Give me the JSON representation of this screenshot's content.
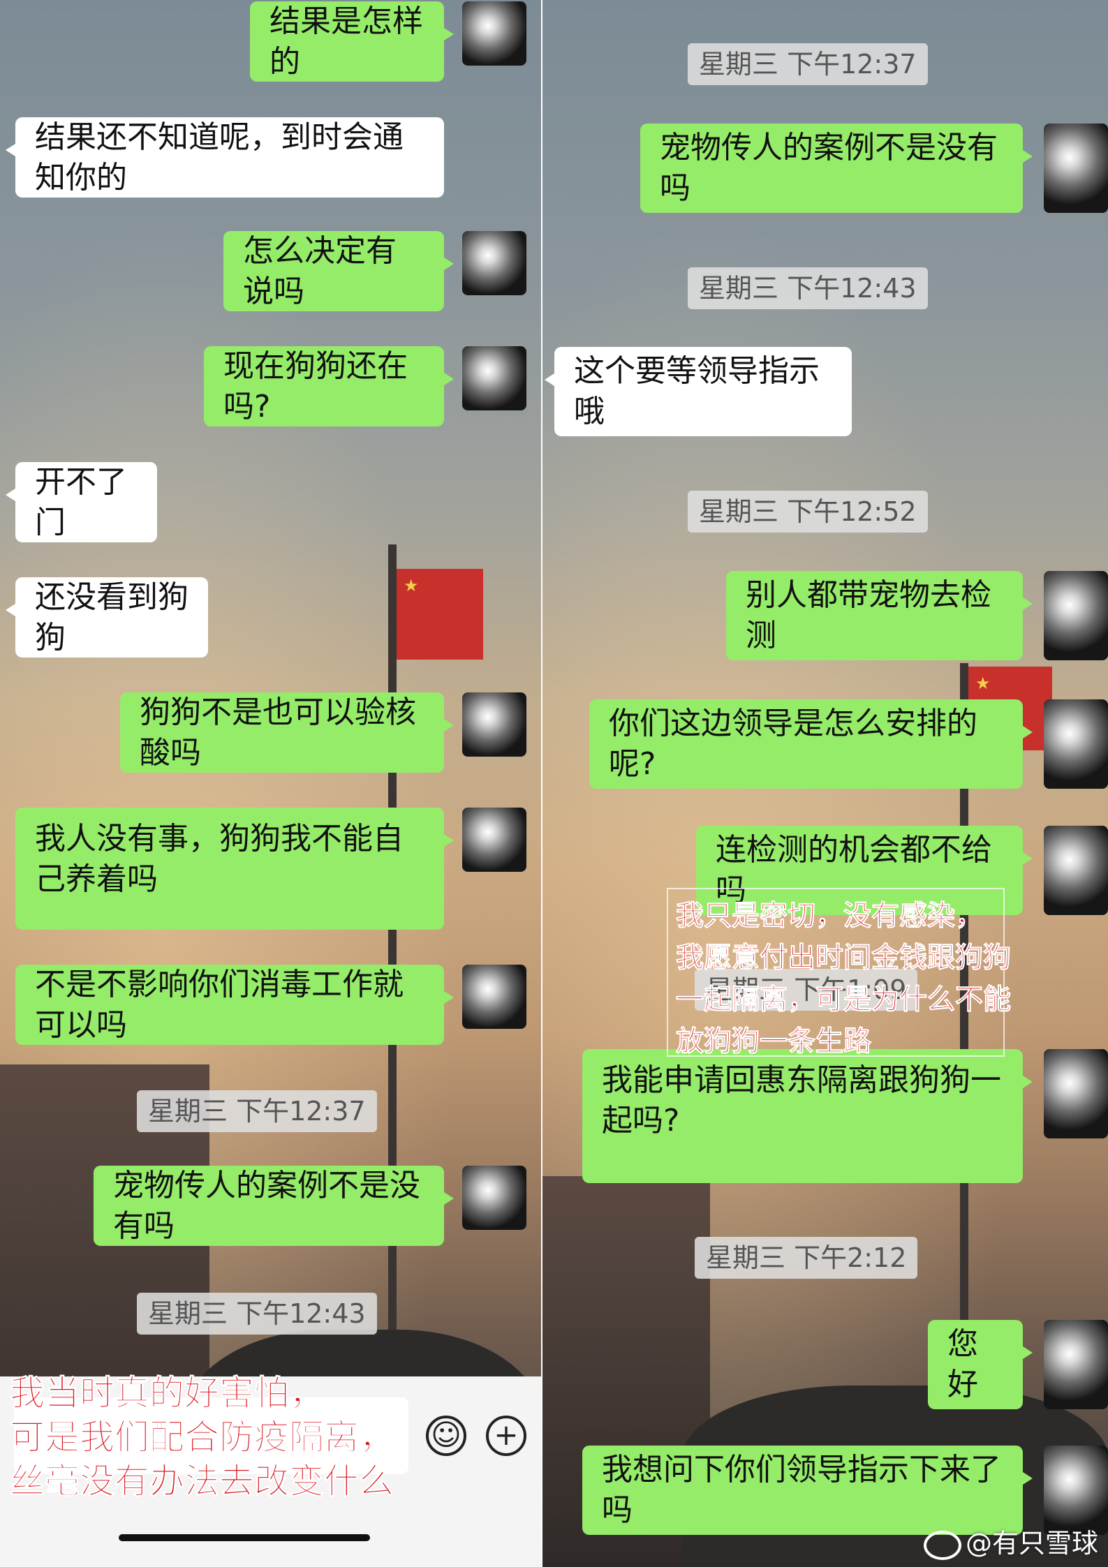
{
  "left_panel": {
    "messages": [
      {
        "side": "me",
        "text": "结果是怎样的"
      },
      {
        "side": "other",
        "text": "结果还不知道呢，到时会通知你的"
      },
      {
        "side": "me",
        "text": "怎么决定有说吗"
      },
      {
        "side": "me",
        "text": "现在狗狗还在吗?"
      },
      {
        "side": "other",
        "text": "开不了门"
      },
      {
        "side": "other",
        "text": "还没看到狗狗"
      },
      {
        "side": "me",
        "text": "狗狗不是也可以验核酸吗"
      },
      {
        "side": "me",
        "text": "我人没有事，狗狗我不能自己养着吗"
      },
      {
        "side": "me",
        "text": "不是不影响你们消毒工作就可以吗"
      },
      {
        "side": "time",
        "text": "星期三 下午12:37"
      },
      {
        "side": "me",
        "text": "宠物传人的案例不是没有吗"
      },
      {
        "side": "time",
        "text": "星期三 下午12:43"
      }
    ],
    "caption_lines": [
      "我当时真的好害怕，",
      "可是我们配合防疫隔离，",
      "丝毫没有办法去改变什么"
    ],
    "input_bar": {
      "emoji_icon": "smiley-icon",
      "plus_icon": "plus-icon"
    }
  },
  "right_panel": {
    "messages": [
      {
        "side": "time",
        "text": "星期三 下午12:37"
      },
      {
        "side": "me",
        "text": "宠物传人的案例不是没有吗"
      },
      {
        "side": "time",
        "text": "星期三 下午12:43"
      },
      {
        "side": "other",
        "text": "这个要等领导指示哦"
      },
      {
        "side": "time",
        "text": "星期三 下午12:52"
      },
      {
        "side": "me",
        "text": "别人都带宠物去检测"
      },
      {
        "side": "me",
        "text": "你们这边领导是怎么安排的呢?"
      },
      {
        "side": "me",
        "text": "连检测的机会都不给吗"
      },
      {
        "side": "time",
        "text": "星期三 下午1:09"
      },
      {
        "side": "me",
        "text": "我能申请回惠东隔离跟狗狗一起吗?"
      },
      {
        "side": "time",
        "text": "星期三 下午2:12"
      },
      {
        "side": "me",
        "text": "您好"
      },
      {
        "side": "me",
        "text": "我想问下你们领导指示下来了吗"
      }
    ],
    "caption_lines": [
      "我只是密切，没有感染，",
      "我愿意付出时间金钱跟狗狗",
      "一起隔离，可是为什么不能",
      "放狗狗一条生路"
    ]
  },
  "watermark": "@有只雪球",
  "colors": {
    "my_bubble": "#95ec69",
    "their_bubble": "#ffffff",
    "caption_red": "#d8141c",
    "timestamp_bg": "#dedede"
  }
}
